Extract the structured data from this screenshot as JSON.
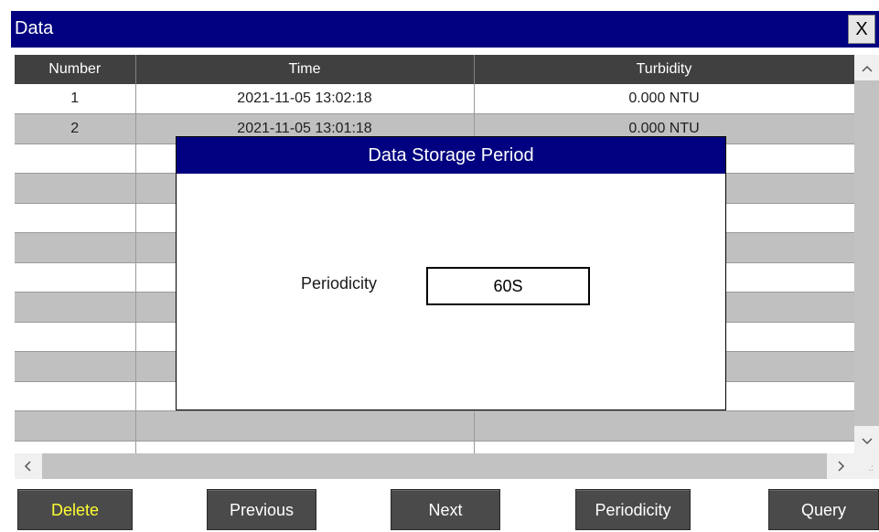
{
  "window": {
    "title": "Data",
    "close_label": "X"
  },
  "table": {
    "headers": [
      "Number",
      "Time",
      "Turbidity"
    ],
    "rows": [
      [
        "1",
        "2021-11-05 13:02:18",
        "0.000 NTU"
      ],
      [
        "2",
        "2021-11-05 13:01:18",
        "0.000 NTU"
      ],
      [
        "",
        "",
        ""
      ],
      [
        "",
        "",
        ""
      ],
      [
        "",
        "",
        ""
      ],
      [
        "",
        "",
        ""
      ],
      [
        "",
        "",
        ""
      ],
      [
        "",
        "",
        ""
      ],
      [
        "",
        "",
        ""
      ],
      [
        "",
        "",
        ""
      ],
      [
        "",
        "",
        ""
      ],
      [
        "",
        "",
        ""
      ],
      [
        "",
        "",
        ""
      ]
    ]
  },
  "scrollbars": {
    "up_icon": "^",
    "down_icon": "v",
    "left_icon": "<",
    "right_icon": ">"
  },
  "buttons": {
    "delete": "Delete",
    "previous": "Previous",
    "next": "Next",
    "periodicity": "Periodicity",
    "query": "Query"
  },
  "dialog": {
    "title": "Data Storage Period",
    "periodicity_label": "Periodicity",
    "periodicity_value": "60S"
  },
  "colors": {
    "title_bar": "#000080",
    "header_row": "#404040",
    "alt_row": "#c0c0c0",
    "button": "#4a4a4a",
    "delete_text": "#ffff33"
  }
}
